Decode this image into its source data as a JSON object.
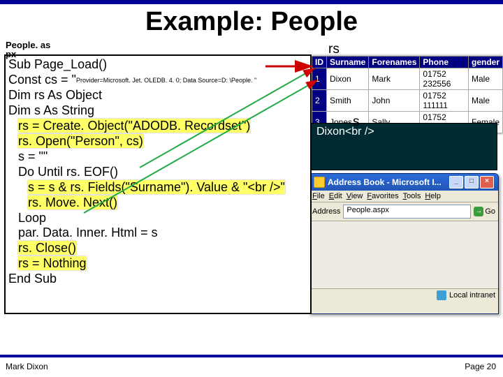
{
  "title": "Example: People",
  "fileLabel": "People. as\npx",
  "rsLabel": "rs",
  "sLabel": "s",
  "sContent": "Dixon<br />",
  "code": {
    "l1": "Sub Page_Load()",
    "l2a": "Const cs = \"",
    "l2b": "Provider=Microsoft. Jet. OLEDB. 4. 0; Data Source=D: \\People. \"",
    "l3": "Dim rs As Object",
    "l4": "Dim s As String",
    "l5": "rs = Create. Object(\"ADODB. Recordset\")",
    "l6": "rs. Open(\"Person\", cs)",
    "l7": "s = \"\"",
    "l8": "Do Until rs. EOF()",
    "l9": "s = s & rs. Fields(\"Surname\"). Value & \"<br />\"",
    "l10": "rs. Move. Next()",
    "l11": "Loop",
    "l12": "par. Data. Inner. Html = s",
    "l13": "rs. Close()",
    "l14": "rs = Nothing",
    "l15": "End Sub"
  },
  "table": {
    "headers": [
      "ID",
      "Surname",
      "Forenames",
      "Phone",
      "gender"
    ],
    "rows": [
      [
        "1",
        "Dixon",
        "Mark",
        "01752 232556",
        "Male"
      ],
      [
        "2",
        "Smith",
        "John",
        "01752 111111",
        "Male"
      ],
      [
        "3",
        "Jones",
        "Sally",
        "01752 888888",
        "Female"
      ]
    ]
  },
  "ie": {
    "title": "Address Book - Microsoft I...",
    "menu": [
      "File",
      "Edit",
      "View",
      "Favorites",
      "Tools",
      "Help"
    ],
    "addressLabel": "Address",
    "addressValue": "People.aspx",
    "go": "Go",
    "status": "Local intranet"
  },
  "footer": {
    "left": "Mark Dixon",
    "right": "Page 20"
  }
}
